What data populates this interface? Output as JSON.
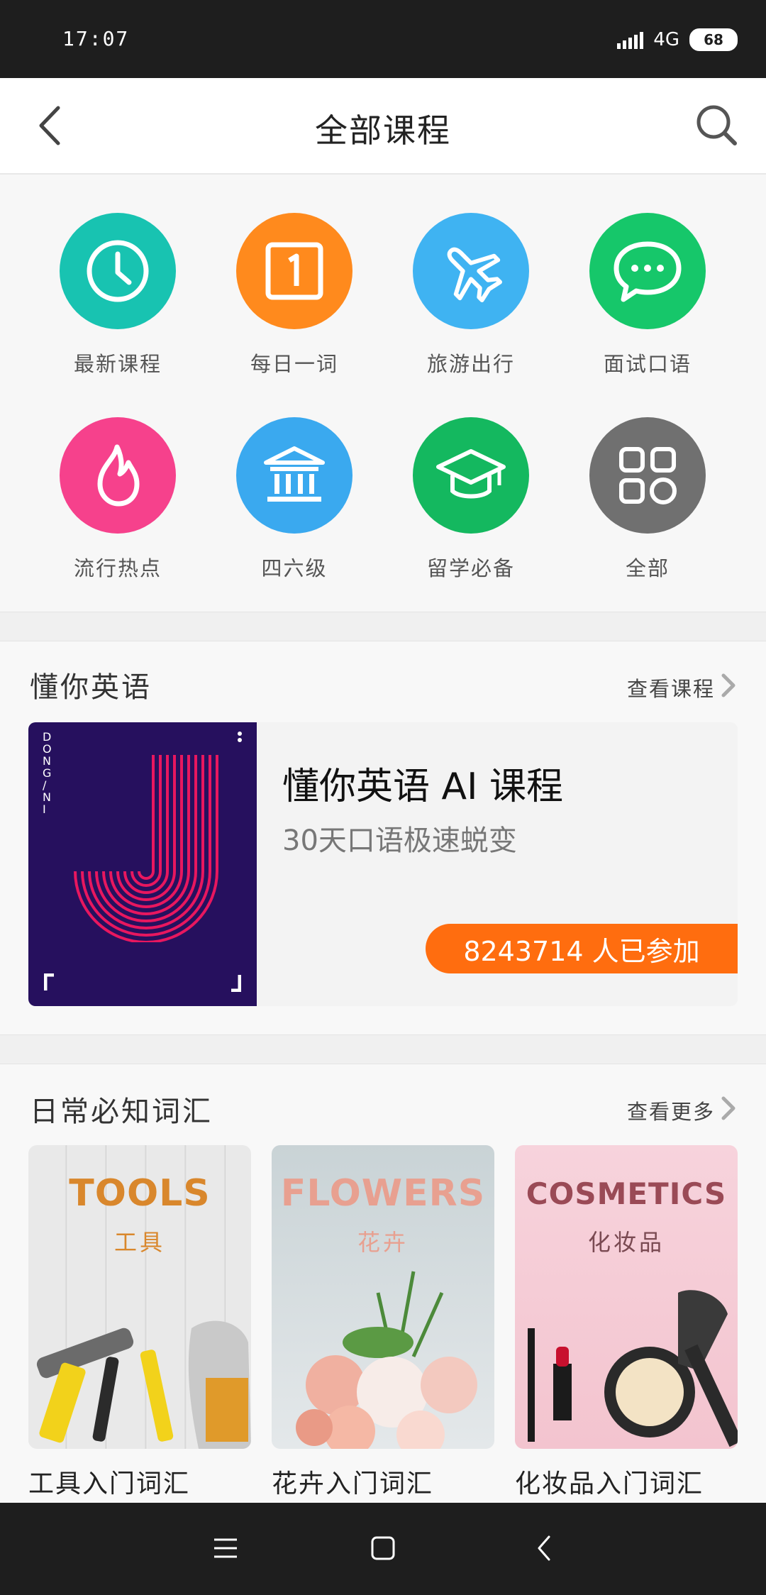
{
  "status_bar": {
    "time": "17:07",
    "network": "4G",
    "battery": "68"
  },
  "header": {
    "title": "全部课程"
  },
  "categories": [
    {
      "label": "最新课程",
      "color": "#18c3b1",
      "icon": "clock-icon"
    },
    {
      "label": "每日一词",
      "color": "#ff8a1d",
      "icon": "calendar-one-icon"
    },
    {
      "label": "旅游出行",
      "color": "#3fb3f2",
      "icon": "airplane-icon"
    },
    {
      "label": "面试口语",
      "color": "#16c76a",
      "icon": "chat-bubble-icon"
    },
    {
      "label": "流行热点",
      "color": "#f6418c",
      "icon": "flame-icon"
    },
    {
      "label": "四六级",
      "color": "#3aa9ef",
      "icon": "institution-icon"
    },
    {
      "label": "留学必备",
      "color": "#14b85f",
      "icon": "graduation-cap-icon"
    },
    {
      "label": "全部",
      "color": "#707070",
      "icon": "grid-apps-icon"
    }
  ],
  "dongni": {
    "section_title": "懂你英语",
    "more_label": "查看课程",
    "cover_text": "D\nO\nN\nG\n/\nN\nI",
    "course_title": "懂你英语 AI 课程",
    "course_subtitle": "30天口语极速蜕变",
    "participants": "8243714 人已参加",
    "accent_color": "#ff6d0f"
  },
  "vocab": {
    "section_title": "日常必知词汇",
    "more_label": "查看更多",
    "items": [
      {
        "cover_en": "TOOLS",
        "cover_cn": "工具",
        "label": "工具入门词汇"
      },
      {
        "cover_en": "FLOWERS",
        "cover_cn": "花卉",
        "label": "花卉入门词汇"
      },
      {
        "cover_en": "COSMETICS",
        "cover_cn": "化妆品",
        "label": "化妆品入门词汇"
      }
    ]
  }
}
